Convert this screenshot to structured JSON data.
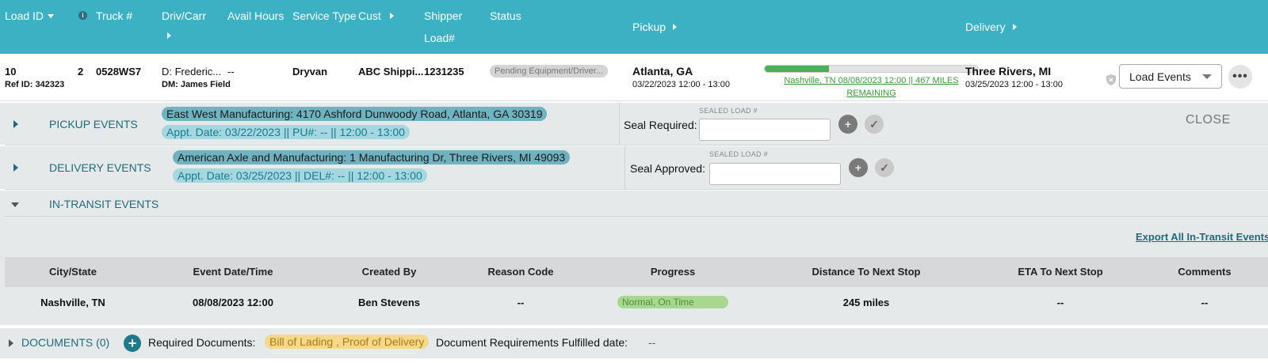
{
  "header": {
    "load_id": "Load ID",
    "truck": "Truck #",
    "driv_carr": "Driv/Carr",
    "avail_hours": "Avail Hours",
    "service_type": "Service Type",
    "cust": "Cust",
    "shipper": "Shipper",
    "load_num": "Load#",
    "status": "Status",
    "pickup": "Pickup",
    "delivery": "Delivery",
    "info_icon_glyph": "i"
  },
  "load": {
    "id": "10",
    "ref_id": "Ref ID: 342323",
    "stops": "2",
    "truck": "0528WS7",
    "driver": "D: Frederic...",
    "dm": "DM: James Field",
    "avail_hours": "--",
    "service_type": "Dryvan",
    "customer": "ABC Shippi...",
    "shipper_load": "1231235",
    "status": "Pending Equipment/Driver...",
    "pickup_city": "Atlanta, GA",
    "pickup_time": "03/22/2023 12:00 - 13:00",
    "progress_fraction": 0.3,
    "progress_text": "Nashville, TN 08/08/2023 12:00 || 467 MILES REMAINING",
    "delivery_city": "Three Rivers, MI",
    "delivery_time": "03/25/2023 12:00 - 13:00",
    "load_events_select": "Load Events",
    "more_glyph": "•••"
  },
  "pickup_events": {
    "label": "PICKUP EVENTS",
    "address": "East West Manufacturing: 4170 Ashford Dunwoody Road, Atlanta, GA 30319",
    "appt": "Appt. Date: 03/22/2023 || PU#: -- || 12:00 - 13:00",
    "seal_label": "Seal Required:",
    "seal_caption": "SEALED LOAD #",
    "seal_value": "",
    "close_label": "CLOSE"
  },
  "delivery_events": {
    "label": "DELIVERY EVENTS",
    "address": "American Axle and Manufacturing: 1 Manufacturing Dr, Three Rivers, MI 49093",
    "appt": "Appt. Date: 03/25/2023 || DEL#: -- || 12:00 - 13:00",
    "seal_label": "Seal Approved:",
    "seal_caption": "SEALED LOAD #",
    "seal_value": ""
  },
  "in_transit": {
    "label": "IN-TRANSIT EVENTS",
    "export_label": "Export All In-Transit Events",
    "columns": [
      "City/State",
      "Event Date/Time",
      "Created By",
      "Reason Code",
      "Progress",
      "Distance To Next Stop",
      "ETA To Next Stop",
      "Comments"
    ],
    "rows": [
      {
        "city_state": "Nashville, TN",
        "event_datetime": "08/08/2023 12:00",
        "created_by": "Ben Stevens",
        "reason_code": "--",
        "progress": "Normal, On Time",
        "distance": "245 miles",
        "eta": "--",
        "comments": "--"
      }
    ]
  },
  "documents": {
    "label": "DOCUMENTS (0)",
    "add_glyph": "+",
    "required_label": "Required Documents:",
    "required_value": "Bill of Lading , Proof of Delivery",
    "fulfilled_label": "Document Requirements Fulfilled date:",
    "fulfilled_value": "--"
  },
  "icons": {
    "plus_glyph": "+",
    "check_glyph": "✓"
  },
  "colors": {
    "header_bg": "#3db1c4",
    "accent_teal": "#1f6b7b",
    "progress_green": "#4caf5a",
    "section_bg": "#e6e9ea"
  }
}
